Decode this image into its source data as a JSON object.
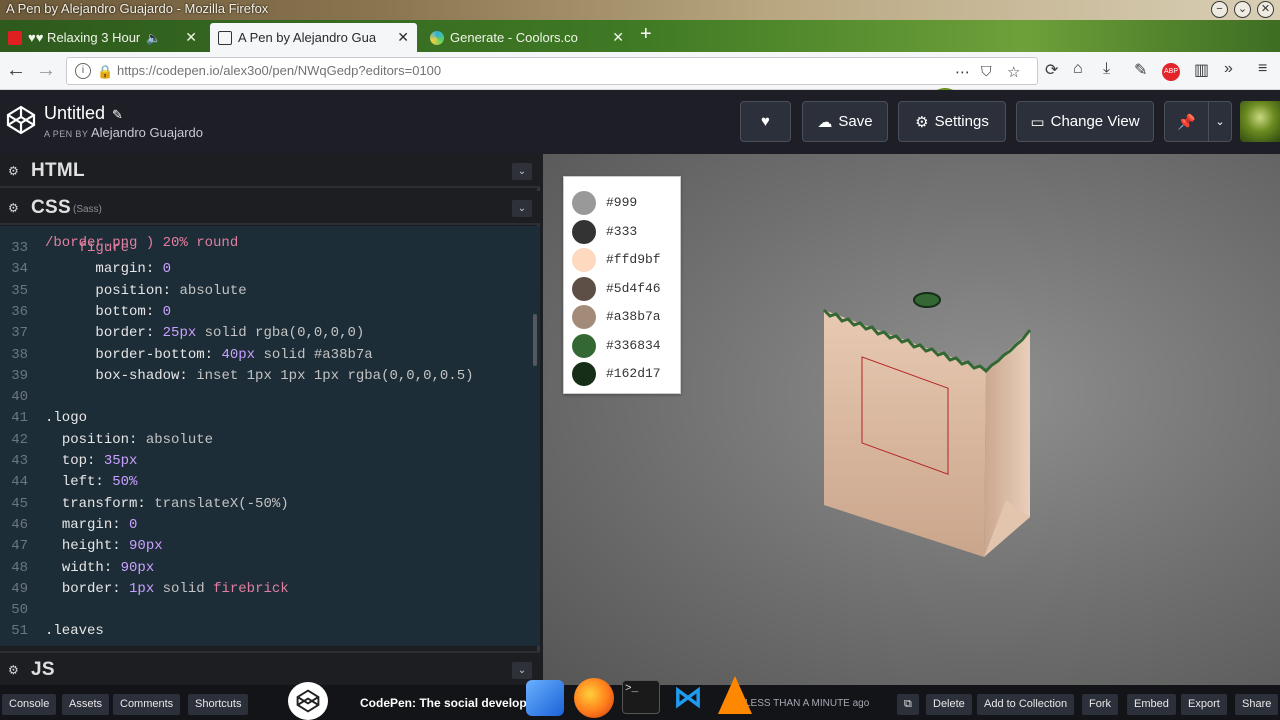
{
  "window": {
    "title": "A Pen by Alejandro Guajardo - Mozilla Firefox"
  },
  "tabs": [
    {
      "label": "♥♥ Relaxing 3 Hour",
      "icon": "youtube-icon",
      "audio": true,
      "active": false
    },
    {
      "label": "A Pen by Alejandro Gua",
      "icon": "codepen-icon",
      "active": true
    },
    {
      "label": "Generate - Coolors.co",
      "icon": "coolors-icon",
      "active": false
    }
  ],
  "nav": {
    "url": "https://codepen.io/alex3o0/pen/NWqGedp?editors=0100"
  },
  "header": {
    "title": "Untitled",
    "by_prefix": "A PEN BY",
    "author": "Alejandro Guajardo",
    "save_label": "Save",
    "settings_label": "Settings",
    "change_view_label": "Change View"
  },
  "editors": {
    "html_label": "HTML",
    "css_label": "CSS",
    "css_sub": "(Sass)",
    "js_label": "JS"
  },
  "code": {
    "top_partial": "/border.png ) 20% round",
    "lines": [
      {
        "n": "33",
        "indent": "    ",
        "parts": [
          [
            "kw",
            "figure"
          ]
        ]
      },
      {
        "n": "34",
        "indent": "      ",
        "parts": [
          [
            "sel",
            "margin: "
          ],
          [
            "num",
            "0"
          ]
        ]
      },
      {
        "n": "35",
        "indent": "      ",
        "parts": [
          [
            "sel",
            "position: "
          ],
          [
            "fn",
            "absolute"
          ]
        ]
      },
      {
        "n": "36",
        "indent": "      ",
        "parts": [
          [
            "sel",
            "bottom: "
          ],
          [
            "num",
            "0"
          ]
        ]
      },
      {
        "n": "37",
        "indent": "      ",
        "parts": [
          [
            "sel",
            "border: "
          ],
          [
            "num",
            "25px"
          ],
          [
            "fn",
            " solid rgba(0,0,0,0)"
          ]
        ]
      },
      {
        "n": "38",
        "indent": "      ",
        "parts": [
          [
            "sel",
            "border-bottom: "
          ],
          [
            "num",
            "40px"
          ],
          [
            "fn",
            " solid #a38b7a"
          ]
        ]
      },
      {
        "n": "39",
        "indent": "      ",
        "parts": [
          [
            "sel",
            "box-shadow: "
          ],
          [
            "fn",
            "inset 1px 1px 1px rgba(0,0,0,0.5)"
          ]
        ]
      },
      {
        "n": "40",
        "indent": "",
        "parts": []
      },
      {
        "n": "41",
        "indent": "",
        "parts": [
          [
            "sel",
            ".logo"
          ]
        ]
      },
      {
        "n": "42",
        "indent": "  ",
        "parts": [
          [
            "sel",
            "position: "
          ],
          [
            "fn",
            "absolute"
          ]
        ]
      },
      {
        "n": "43",
        "indent": "  ",
        "parts": [
          [
            "sel",
            "top: "
          ],
          [
            "num",
            "35px"
          ]
        ]
      },
      {
        "n": "44",
        "indent": "  ",
        "parts": [
          [
            "sel",
            "left: "
          ],
          [
            "num",
            "50%"
          ]
        ]
      },
      {
        "n": "45",
        "indent": "  ",
        "parts": [
          [
            "sel",
            "transform: "
          ],
          [
            "fn",
            "translateX(-50%)"
          ]
        ]
      },
      {
        "n": "46",
        "indent": "  ",
        "parts": [
          [
            "sel",
            "margin: "
          ],
          [
            "num",
            "0"
          ]
        ]
      },
      {
        "n": "47",
        "indent": "  ",
        "parts": [
          [
            "sel",
            "height: "
          ],
          [
            "num",
            "90px"
          ]
        ]
      },
      {
        "n": "48",
        "indent": "  ",
        "parts": [
          [
            "sel",
            "width: "
          ],
          [
            "num",
            "90px"
          ]
        ]
      },
      {
        "n": "49",
        "indent": "  ",
        "parts": [
          [
            "sel",
            "border: "
          ],
          [
            "num",
            "1px"
          ],
          [
            "fn",
            " solid "
          ],
          [
            "kw",
            "firebrick"
          ]
        ]
      },
      {
        "n": "50",
        "indent": "",
        "parts": []
      },
      {
        "n": "51",
        "indent": "",
        "parts": [
          [
            "sel",
            ".leaves"
          ]
        ]
      }
    ]
  },
  "palette": [
    {
      "hex": "#999",
      "color": "#999999"
    },
    {
      "hex": "#333",
      "color": "#333333"
    },
    {
      "hex": "#ffd9bf",
      "color": "#ffd9bf"
    },
    {
      "hex": "#5d4f46",
      "color": "#5d4f46"
    },
    {
      "hex": "#a38b7a",
      "color": "#a38b7a"
    },
    {
      "hex": "#336834",
      "color": "#336834"
    },
    {
      "hex": "#162d17",
      "color": "#162d17"
    }
  ],
  "footer": {
    "console": "Console",
    "assets": "Assets",
    "comments": "Comments",
    "shortcuts": "Shortcuts",
    "last_saved": "LESS THAN A MINUTE ago",
    "delete": "Delete",
    "add_to_collection": "Add to Collection",
    "fork": "Fork",
    "embed": "Embed",
    "export": "Export",
    "share": "Share"
  },
  "taskbar": {
    "window_title": "CodePen: The social developm"
  }
}
